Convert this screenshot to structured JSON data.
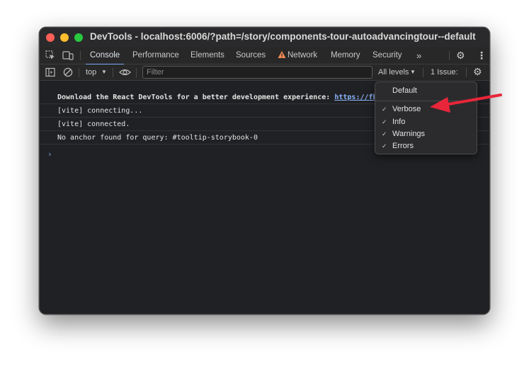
{
  "window": {
    "title": "DevTools - localhost:6006/?path=/story/components-tour-autoadvancingtour--default"
  },
  "tabs": [
    {
      "label": "Console",
      "active": true
    },
    {
      "label": "Performance"
    },
    {
      "label": "Elements"
    },
    {
      "label": "Sources"
    },
    {
      "label": "Network",
      "warning_icon": "warning-triangle-icon"
    },
    {
      "label": "Memory"
    },
    {
      "label": "Security"
    }
  ],
  "tabbar": {
    "more_icon": "»",
    "settings_icon": "⚙",
    "menu_icon": "⋮"
  },
  "toolbar": {
    "context": "top",
    "filter_placeholder": "Filter",
    "levels_label": "All levels",
    "issues_label": "1 Issue:"
  },
  "console": {
    "messages": [
      {
        "text": "Download the React DevTools for a better development experience: ",
        "link": "https://fb",
        "bold": true
      },
      {
        "text": "[vite] connecting..."
      },
      {
        "text": "[vite] connected."
      },
      {
        "text": "No anchor found for query: #tooltip-storybook-0"
      }
    ],
    "prompt": "›"
  },
  "levels_menu": {
    "items": [
      {
        "label": "Default",
        "checked": false
      },
      {
        "label": "Verbose",
        "checked": true
      },
      {
        "label": "Info",
        "checked": true
      },
      {
        "label": "Warnings",
        "checked": true
      },
      {
        "label": "Errors",
        "checked": true
      }
    ],
    "check_glyph": "✓"
  },
  "colors": {
    "accent": "#7cacf8",
    "annotation_arrow": "#e8263a",
    "warning": "#f28b54"
  }
}
